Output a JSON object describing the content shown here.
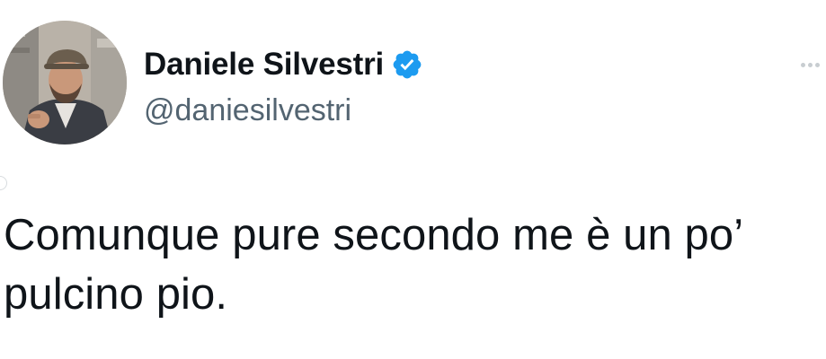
{
  "tweet": {
    "author": {
      "display_name": "Daniele Silvestri",
      "handle": "@daniesilvestri",
      "verified": true,
      "verified_color": "#1d9bf0"
    },
    "text": "Comunque pure secondo me è un po’\npulcino pio.",
    "icons": {
      "avatar": "avatar",
      "verified": "verified-badge-icon",
      "more": "more-options-icon"
    }
  }
}
